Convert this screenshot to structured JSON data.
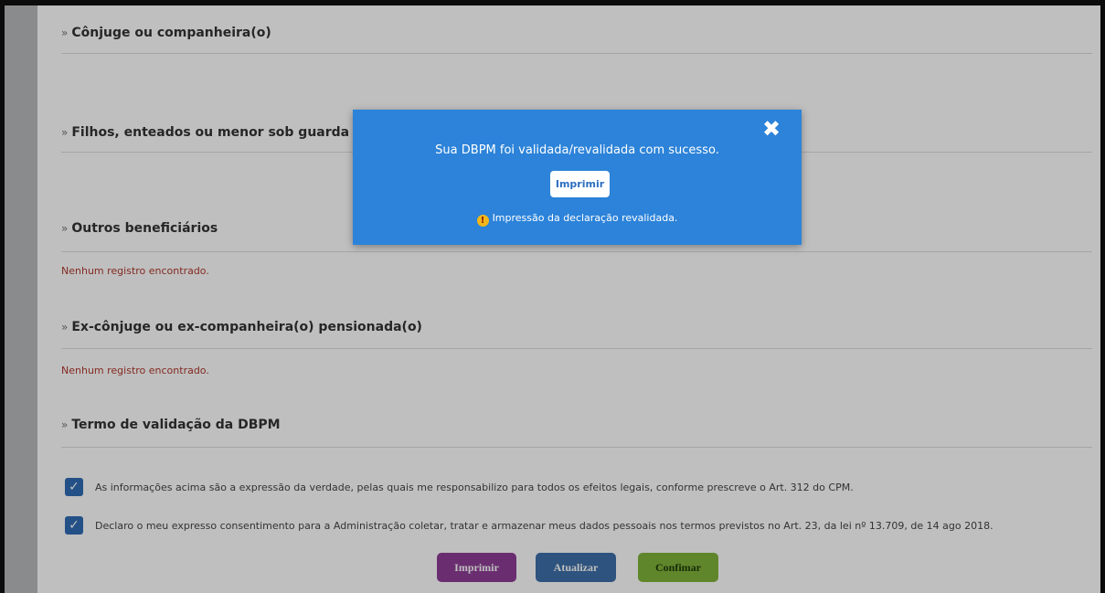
{
  "sections": [
    {
      "title": "Cônjuge ou companheira(o)"
    },
    {
      "title": "Filhos, enteados ou menor sob guarda ou"
    },
    {
      "title": "Outros beneficiários",
      "empty": "Nenhum registro encontrado."
    },
    {
      "title": "Ex-cônjuge ou ex-companheira(o) pensionada(o)",
      "empty": "Nenhum registro encontrado."
    },
    {
      "title": "Termo de validação da DBPM"
    }
  ],
  "chevron": "»",
  "checks": [
    {
      "text": "As informações acima são a expressão da verdade, pelas quais me responsabilizo para todos os efeitos legais, conforme prescreve o Art. 312 do CPM.",
      "checked": true
    },
    {
      "text": "Declaro o meu expresso consentimento para a Administração coletar, tratar e armazenar meus dados pessoais nos termos previstos no Art. 23, da lei nº 13.709, de 14 ago 2018.",
      "checked": true
    }
  ],
  "buttons": {
    "print": "Imprimir",
    "update": "Atualizar",
    "confirm": "Confimar"
  },
  "modal": {
    "message": "Sua DBPM foi validada/revalidada com sucesso.",
    "button": "Imprimir",
    "note": "Impressão da declaração revalidada.",
    "close_icon": "close-icon",
    "warning_icon": "warning-icon"
  },
  "colors": {
    "modal": "#2c83d9",
    "print": "#8e3e96",
    "update": "#3d6fa8",
    "confirm": "#7fb33a",
    "empty": "#b03a2e"
  }
}
